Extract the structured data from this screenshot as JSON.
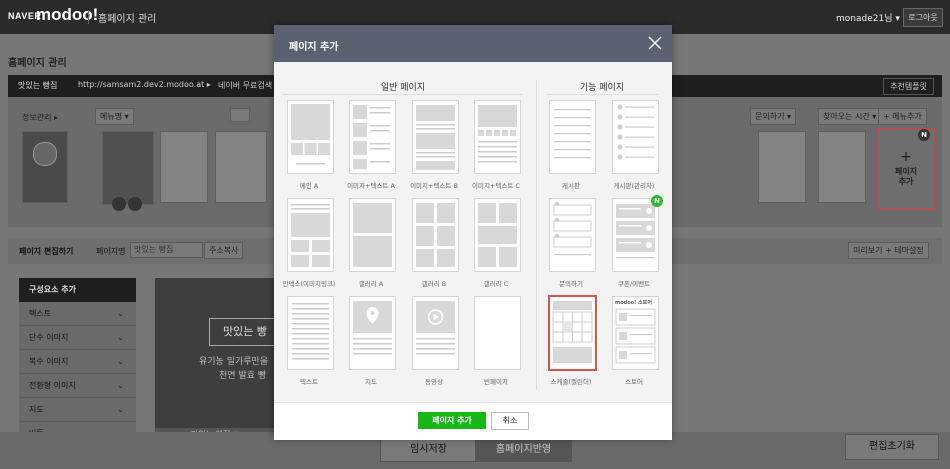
{
  "topbar": {
    "brand": "NAVER",
    "logo": "modoo!",
    "nav": "홈페이지 관리",
    "user": "monade21님 ▾",
    "logout": "로그아웃"
  },
  "background": {
    "page_title": "홈페이지 관리",
    "site_label": "맛있는 빵집",
    "site_url": "http://samsam2.dev2.modoo.at ▸",
    "register_link": "네이버 무료검색 등록 ▸",
    "recommend_button": "추천템플릿",
    "info_manage": "정보관리 ▸",
    "menu_tab": "메뉴명 ▾",
    "menu_add": "+ 메뉴추가",
    "inquiry": "문의하기 ▾",
    "directions": "찾아오는 시간 ▾",
    "add_page_plus": "+",
    "add_page_label": "페이지\n추가",
    "new_badge": "N",
    "edit_title": "페이지 편집하기",
    "page_name_label": "페이지명",
    "page_name_value": "맛있는 빵집",
    "address_copy": "주소복사",
    "preview_theme": "미리보기 + 테마설정",
    "sidebar_header": "구성요소 추가",
    "sidebar_items": [
      "텍스트",
      "단수 이미지",
      "복수 이미지",
      "전환형 이미지",
      "지도",
      "버튼"
    ],
    "canvas_heading": "맛있는 빵",
    "canvas_line1": "유기농 밀가루만을",
    "canvas_line2": "천연 발효 빵",
    "canvas_button": "맛있는 빵집 ▼",
    "save_temp": "임시저장",
    "publish": "홈페이지반영",
    "reset": "편집초기화"
  },
  "modal": {
    "title": "페이지 추가",
    "general_title": "일반 페이지",
    "function_title": "기능 페이지",
    "general_pages": [
      "메인 A",
      "이미지+텍스트 A",
      "이미지+텍스트 B",
      "이미지+텍스트 C",
      "인덱스(이미지링크)",
      "갤러리 A",
      "갤러리 B",
      "갤러리 C",
      "텍스트",
      "지도",
      "동영상",
      "빈페이지"
    ],
    "function_pages": [
      "게시판",
      "게시판(관리자)",
      "문의하기",
      "쿠폰/이벤트",
      "스케줄(캘린더)",
      "스토어"
    ],
    "store_mini_label": "modoo! 스토어",
    "new_badge": "N",
    "ok_button": "페이지 추가",
    "cancel_button": "취소"
  }
}
